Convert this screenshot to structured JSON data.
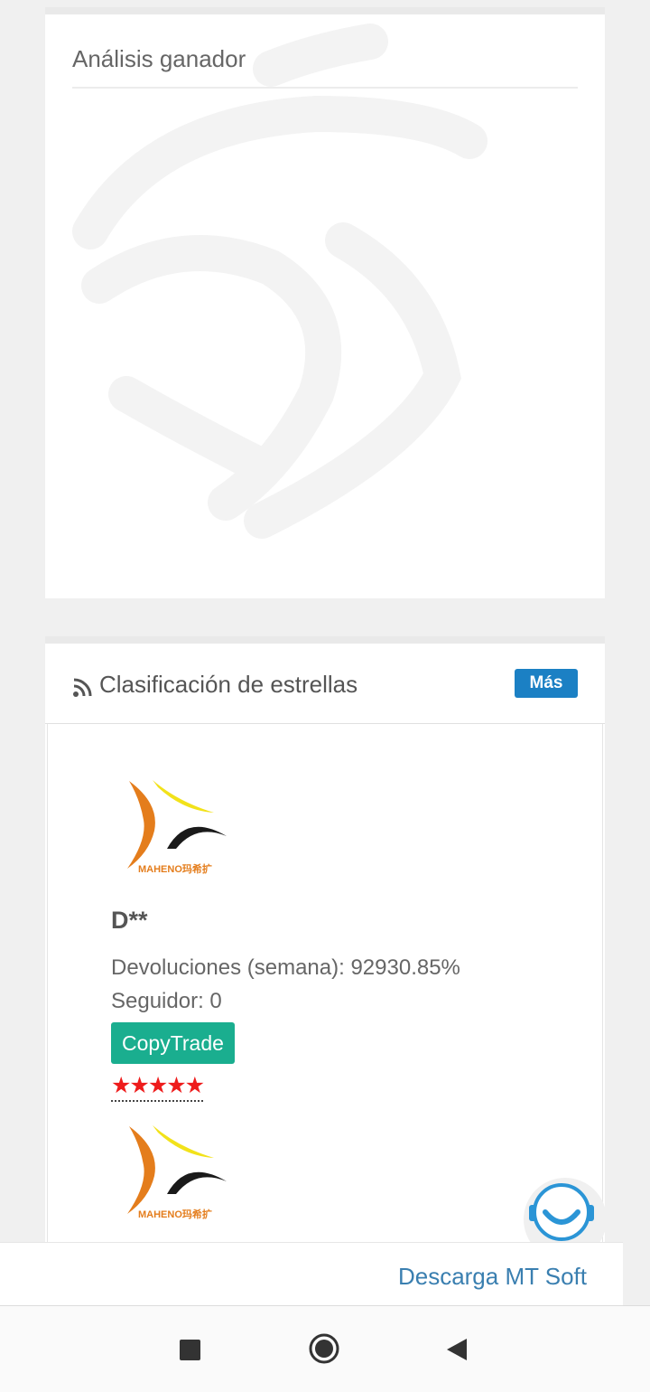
{
  "analysis": {
    "title": "Análisis ganador"
  },
  "ranking": {
    "title": "Clasificación de estrellas",
    "more_label": "Más",
    "traders": [
      {
        "logo_text": "MAHENO玛希扩",
        "name": "D**",
        "returns": "Devoluciones (semana): 92930.85%",
        "followers": "Seguidor: 0",
        "copy_label": "CopyTrade",
        "stars": "★★★★★"
      },
      {
        "logo_text": "MAHENO玛希扩"
      }
    ]
  },
  "footer": {
    "download_label": "Descarga MT Soft"
  },
  "icons": {
    "rss": "rss-icon",
    "support": "customer-support-icon",
    "nav_recents": "square-icon",
    "nav_home": "circle-icon",
    "nav_back": "triangle-back-icon"
  },
  "colors": {
    "more_button": "#1b80c4",
    "copytrade_button": "#1aae8f",
    "stars": "#ee1c1c",
    "link": "#3a7fb0",
    "logo_orange": "#e47d1c",
    "logo_yellow": "#f2e21a"
  }
}
